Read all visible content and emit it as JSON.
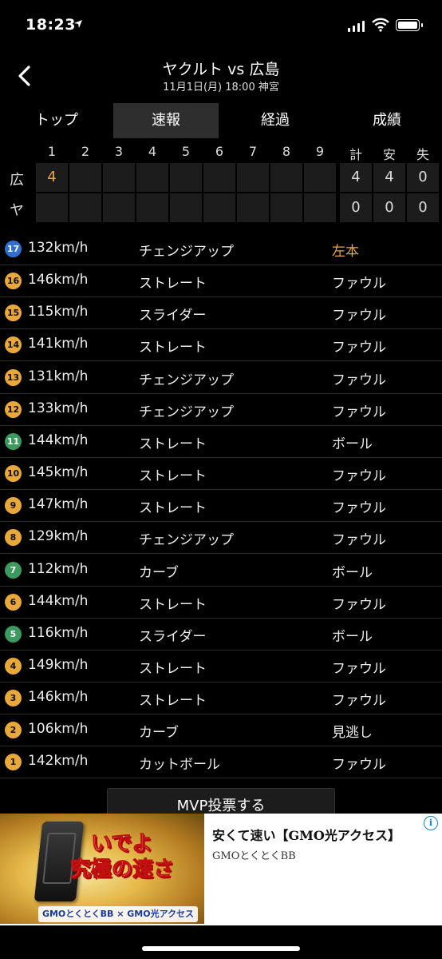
{
  "status_bar": {
    "time": "18:23"
  },
  "header": {
    "title": "ヤクルト vs 広島",
    "subtitle": "11月1日(月) 18:00 神宮"
  },
  "tabs": [
    {
      "label": "トップ",
      "active": false
    },
    {
      "label": "速報",
      "active": true
    },
    {
      "label": "経過",
      "active": false
    },
    {
      "label": "成績",
      "active": false
    }
  ],
  "scoreboard": {
    "innings": [
      "1",
      "2",
      "3",
      "4",
      "5",
      "6",
      "7",
      "8",
      "9"
    ],
    "totals_headers": [
      "計",
      "安",
      "失"
    ],
    "teams": [
      {
        "label": "広",
        "innings": [
          "4",
          "",
          "",
          "",
          "",
          "",
          "",
          "",
          ""
        ],
        "totals": [
          "4",
          "4",
          "0"
        ]
      },
      {
        "label": "ヤ",
        "innings": [
          "",
          "",
          "",
          "",
          "",
          "",
          "",
          "",
          ""
        ],
        "totals": [
          "0",
          "0",
          "0"
        ]
      }
    ]
  },
  "colors": {
    "ball": "#3c9a5f",
    "strike": "#e8a93a",
    "accent": "#e8a844"
  },
  "pitches": [
    {
      "no": "17",
      "speed": "132km/h",
      "type": "チェンジアップ",
      "result": "左本",
      "color": "#2f6fd2",
      "highlight": true
    },
    {
      "no": "16",
      "speed": "146km/h",
      "type": "ストレート",
      "result": "ファウル",
      "color": "#e8a93a",
      "highlight": false
    },
    {
      "no": "15",
      "speed": "115km/h",
      "type": "スライダー",
      "result": "ファウル",
      "color": "#e8a93a",
      "highlight": false
    },
    {
      "no": "14",
      "speed": "141km/h",
      "type": "ストレート",
      "result": "ファウル",
      "color": "#e8a93a",
      "highlight": false
    },
    {
      "no": "13",
      "speed": "131km/h",
      "type": "チェンジアップ",
      "result": "ファウル",
      "color": "#e8a93a",
      "highlight": false
    },
    {
      "no": "12",
      "speed": "133km/h",
      "type": "チェンジアップ",
      "result": "ファウル",
      "color": "#e8a93a",
      "highlight": false
    },
    {
      "no": "11",
      "speed": "144km/h",
      "type": "ストレート",
      "result": "ボール",
      "color": "#3c9a5f",
      "highlight": false
    },
    {
      "no": "10",
      "speed": "145km/h",
      "type": "ストレート",
      "result": "ファウル",
      "color": "#e8a93a",
      "highlight": false
    },
    {
      "no": "9",
      "speed": "147km/h",
      "type": "ストレート",
      "result": "ファウル",
      "color": "#e8a93a",
      "highlight": false
    },
    {
      "no": "8",
      "speed": "129km/h",
      "type": "チェンジアップ",
      "result": "ファウル",
      "color": "#e8a93a",
      "highlight": false
    },
    {
      "no": "7",
      "speed": "112km/h",
      "type": "カーブ",
      "result": "ボール",
      "color": "#3c9a5f",
      "highlight": false
    },
    {
      "no": "6",
      "speed": "144km/h",
      "type": "ストレート",
      "result": "ファウル",
      "color": "#e8a93a",
      "highlight": false
    },
    {
      "no": "5",
      "speed": "116km/h",
      "type": "スライダー",
      "result": "ボール",
      "color": "#3c9a5f",
      "highlight": false
    },
    {
      "no": "4",
      "speed": "149km/h",
      "type": "ストレート",
      "result": "ファウル",
      "color": "#e8a93a",
      "highlight": false
    },
    {
      "no": "3",
      "speed": "146km/h",
      "type": "ストレート",
      "result": "ファウル",
      "color": "#e8a93a",
      "highlight": false
    },
    {
      "no": "2",
      "speed": "106km/h",
      "type": "カーブ",
      "result": "見逃し",
      "color": "#e8a93a",
      "highlight": false
    },
    {
      "no": "1",
      "speed": "142km/h",
      "type": "カットボール",
      "result": "ファウル",
      "color": "#e8a93a",
      "highlight": false
    }
  ],
  "mvp_button": {
    "label": "MVP投票する"
  },
  "ad": {
    "catch_line1": "いでよ",
    "catch_line2": "究極の速さ",
    "logos": "GMOとくとくBB × GMO光アクセス",
    "title": "安くて速い【GMO光アクセス】",
    "sponsor": "GMOとくとくBB",
    "info_icon": "i"
  }
}
